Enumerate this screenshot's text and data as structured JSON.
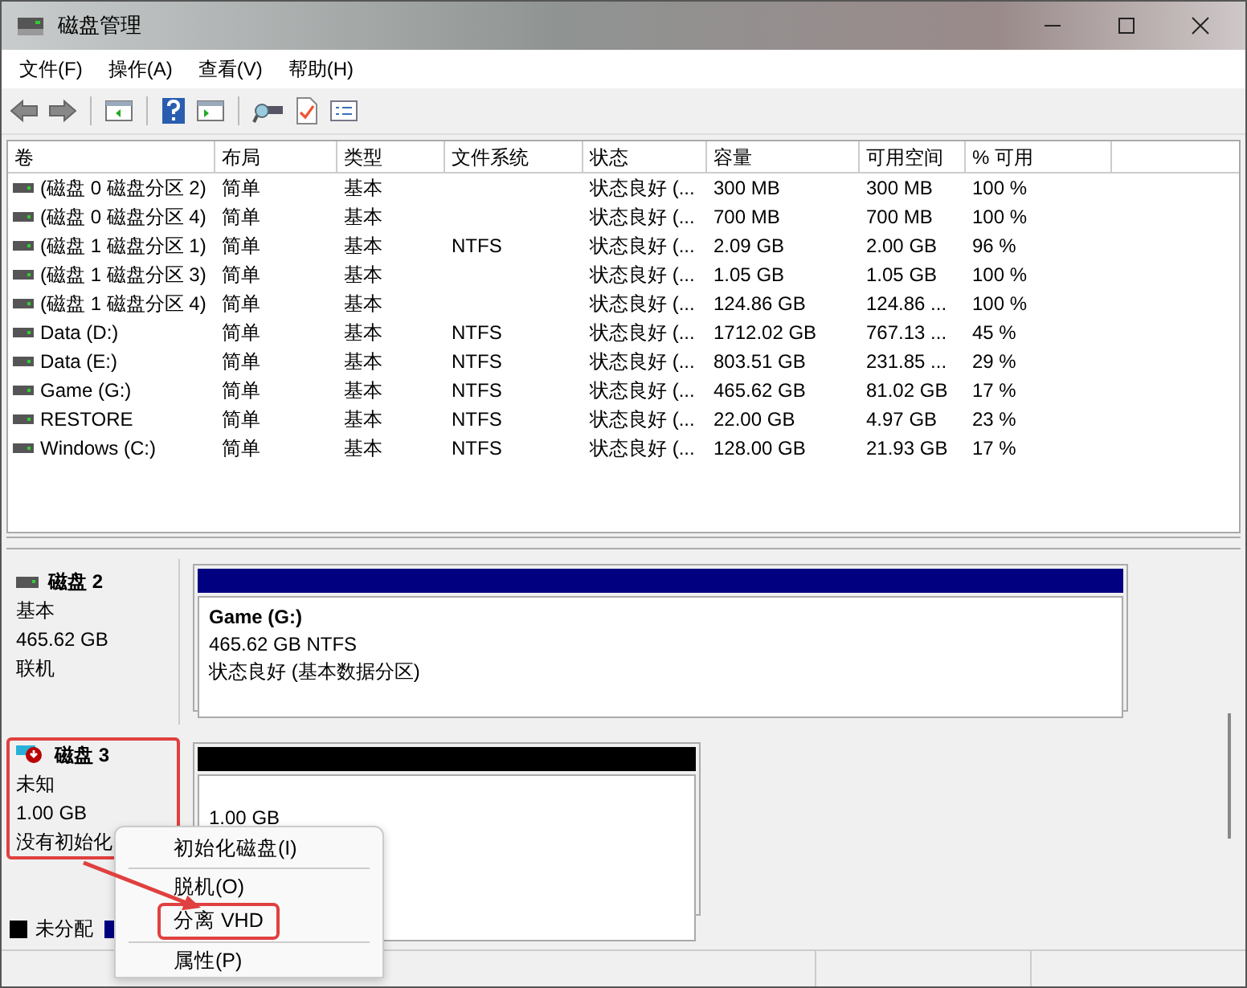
{
  "window": {
    "title": "磁盘管理"
  },
  "menu": [
    "文件(F)",
    "操作(A)",
    "查看(V)",
    "帮助(H)"
  ],
  "table": {
    "columns": [
      "卷",
      "布局",
      "类型",
      "文件系统",
      "状态",
      "容量",
      "可用空间",
      "% 可用"
    ],
    "rows": [
      [
        "(磁盘 0 磁盘分区 2)",
        "简单",
        "基本",
        "",
        "状态良好 (...",
        "300 MB",
        "300 MB",
        "100 %"
      ],
      [
        "(磁盘 0 磁盘分区 4)",
        "简单",
        "基本",
        "",
        "状态良好 (...",
        "700 MB",
        "700 MB",
        "100 %"
      ],
      [
        "(磁盘 1 磁盘分区 1)",
        "简单",
        "基本",
        "NTFS",
        "状态良好 (...",
        "2.09 GB",
        "2.00 GB",
        "96 %"
      ],
      [
        "(磁盘 1 磁盘分区 3)",
        "简单",
        "基本",
        "",
        "状态良好 (...",
        "1.05 GB",
        "1.05 GB",
        "100 %"
      ],
      [
        "(磁盘 1 磁盘分区 4)",
        "简单",
        "基本",
        "",
        "状态良好 (...",
        "124.86 GB",
        "124.86 ...",
        "100 %"
      ],
      [
        "Data (D:)",
        "简单",
        "基本",
        "NTFS",
        "状态良好 (...",
        "1712.02 GB",
        "767.13 ...",
        "45 %"
      ],
      [
        "Data (E:)",
        "简单",
        "基本",
        "NTFS",
        "状态良好 (...",
        "803.51 GB",
        "231.85 ...",
        "29 %"
      ],
      [
        "Game (G:)",
        "简单",
        "基本",
        "NTFS",
        "状态良好 (...",
        "465.62 GB",
        "81.02 GB",
        "17 %"
      ],
      [
        "RESTORE",
        "简单",
        "基本",
        "NTFS",
        "状态良好 (...",
        "22.00 GB",
        "4.97 GB",
        "23 %"
      ],
      [
        "Windows (C:)",
        "简单",
        "基本",
        "NTFS",
        "状态良好 (...",
        "128.00 GB",
        "21.93 GB",
        "17 %"
      ]
    ]
  },
  "disks": [
    {
      "name": "磁盘 2",
      "kind": "online",
      "type": "基本",
      "size": "465.62 GB",
      "status": "联机",
      "annotated": false,
      "partitions": [
        {
          "color": "#000080",
          "name": "Game  (G:)",
          "size": "465.62 GB NTFS",
          "status": "状态良好 (基本数据分区)"
        }
      ]
    },
    {
      "name": "磁盘 3",
      "kind": "unknown",
      "type": "未知",
      "size": "1.00 GB",
      "status": "没有初始化",
      "annotated": true,
      "partitions": [
        {
          "color": "#000000",
          "size": "1.00 GB"
        }
      ]
    }
  ],
  "legend": [
    {
      "label": "未分配",
      "color": "#000000"
    },
    {
      "color": "#000080"
    }
  ],
  "context_menu": [
    {
      "kind": "item",
      "label": "初始化磁盘(I)",
      "annotated": false
    },
    {
      "kind": "separator"
    },
    {
      "kind": "item",
      "label": "脱机(O)",
      "annotated": false
    },
    {
      "kind": "item",
      "label": "分离 VHD",
      "annotated": true
    },
    {
      "kind": "separator"
    },
    {
      "kind": "item",
      "label": "属性(P)",
      "annotated": false
    }
  ]
}
